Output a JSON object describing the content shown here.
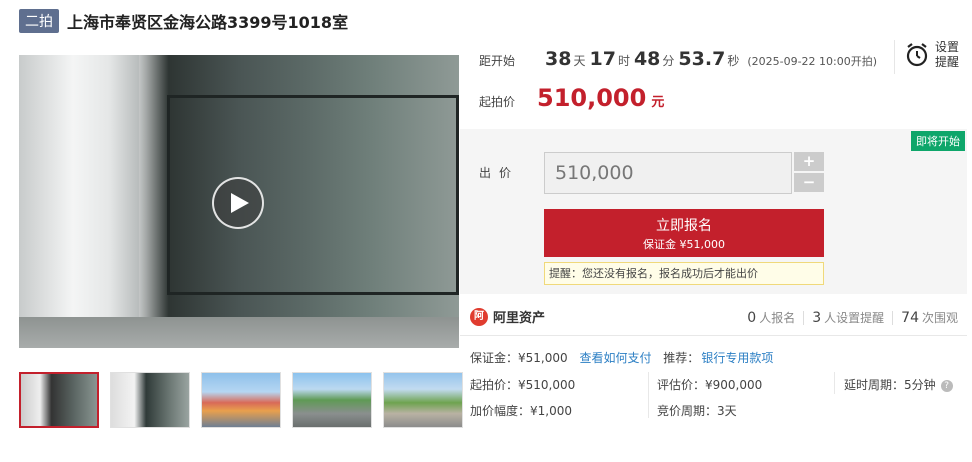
{
  "header": {
    "round_badge": "二拍",
    "title": "上海市奉贤区金海公路3399号1018室"
  },
  "countdown": {
    "label": "距开始",
    "days": "38",
    "days_unit": "天",
    "hours": "17",
    "hours_unit": "时",
    "minutes": "48",
    "minutes_unit": "分",
    "seconds": "53.7",
    "seconds_unit": "秒",
    "start_note": "(2025-09-22 10:00开拍)"
  },
  "remind": {
    "label": "设置提醒",
    "icon": "alarm-clock-icon"
  },
  "starting_price": {
    "label": "起拍价",
    "value": "510,000",
    "unit": "元"
  },
  "bid": {
    "status_tag": "即将开始",
    "label": "出价",
    "value": "510,000",
    "plus": "+",
    "minus": "−",
    "signup_label": "立即报名",
    "deposit_label": "保证金 ¥51,000",
    "notice": "提醒：您还没有报名，报名成功后才能出价"
  },
  "platform": {
    "logo_mark": "阿",
    "name": "阿里资产",
    "signups": "0",
    "signups_label": "人报名",
    "reminders": "3",
    "reminders_label": "人设置提醒",
    "views": "74",
    "views_label": "次围观"
  },
  "details": {
    "deposit": "保证金：¥51,000",
    "how_to_pay": "查看如何支付",
    "recommend_label": "推荐：",
    "recommend_link": "银行专用款项",
    "start_price": "起拍价：¥510,000",
    "appraisal": "评估价：¥900,000",
    "delay_period": "延时周期：5分钟",
    "increment": "加价幅度：¥1,000",
    "bid_period": "竞价周期：3天"
  },
  "colors": {
    "accent_red": "#c3202c",
    "tag_green": "#0ea66a",
    "link_blue": "#2c7fc4",
    "badge_gray": "#5f6f8f"
  }
}
